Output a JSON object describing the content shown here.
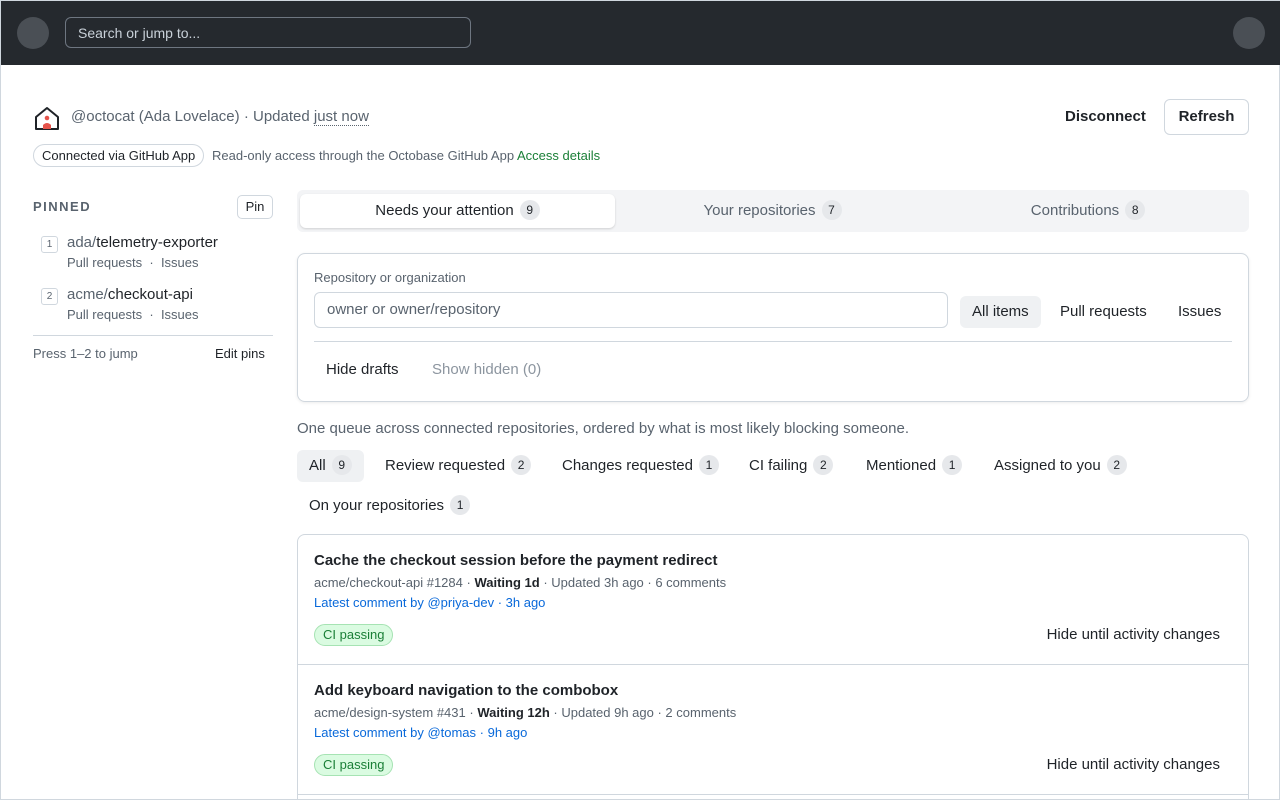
{
  "topbar": {
    "search_placeholder": "Search or jump to..."
  },
  "account": {
    "user": "@octocat (Ada Lovelace)",
    "updated_prefix": "· Updated",
    "updated_value": "just now",
    "disconnect_label": "Disconnect",
    "refresh_label": "Refresh",
    "connection_badge": "Connected via GitHub App",
    "access_text": "Read-only access through the Octobase GitHub App",
    "access_link": "Access details"
  },
  "sidebar": {
    "heading": "PINNED",
    "pin_label": "Pin",
    "pins": [
      {
        "num": "1",
        "owner": "ada/",
        "repo": "telemetry-exporter",
        "pulls": "Pull requests",
        "issues": "Issues"
      },
      {
        "num": "2",
        "owner": "acme/",
        "repo": "checkout-api",
        "pulls": "Pull requests",
        "issues": "Issues"
      }
    ],
    "hint": "Press 1–2 to jump",
    "edit_label": "Edit pins"
  },
  "tabs": [
    {
      "label": "Needs your attention",
      "count": "9"
    },
    {
      "label": "Your repositories",
      "count": "7"
    },
    {
      "label": "Contributions",
      "count": "8"
    }
  ],
  "filter": {
    "repo_label": "Repository or organization",
    "repo_placeholder": "owner or owner/repository",
    "segments": [
      "All items",
      "Pull requests",
      "Issues"
    ],
    "hide_drafts": "Hide drafts",
    "show_hidden": "Show hidden (0)"
  },
  "queue": {
    "description": "One queue across connected repositories, ordered by what is most likely blocking someone.",
    "chips": [
      {
        "label": "All",
        "count": "9"
      },
      {
        "label": "Review requested",
        "count": "2"
      },
      {
        "label": "Changes requested",
        "count": "1"
      },
      {
        "label": "CI failing",
        "count": "2"
      },
      {
        "label": "Mentioned",
        "count": "1"
      },
      {
        "label": "Assigned to you",
        "count": "2"
      },
      {
        "label": "On your repositories",
        "count": "1"
      }
    ]
  },
  "items": [
    {
      "title": "Cache the checkout session before the payment redirect",
      "ref": "acme/checkout-api #1284 ·",
      "waiting": "Waiting 1d",
      "rest": "· Updated 3h ago · 6 comments",
      "latest": "Latest comment by @priya-dev · 3h ago",
      "badge": "CI passing",
      "action": "Hide until activity changes"
    },
    {
      "title": "Add keyboard navigation to the combobox",
      "ref": "acme/design-system #431 ·",
      "waiting": "Waiting 12h",
      "rest": "· Updated 9h ago · 2 comments",
      "latest": "Latest comment by @tomas · 9h ago",
      "badge": "CI passing",
      "action": "Hide until activity changes"
    }
  ]
}
